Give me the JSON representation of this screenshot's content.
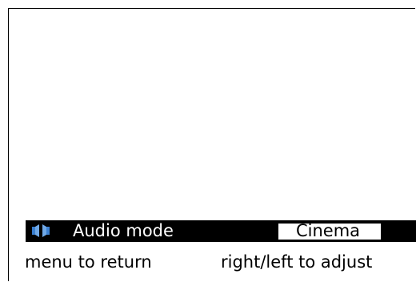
{
  "osd": {
    "icon": "speaker-icon",
    "icon_color": "#3a7fd0",
    "label": "Audio mode",
    "value": "Cinema"
  },
  "hints": {
    "back": "menu to return",
    "adjust": "right/left to adjust"
  }
}
